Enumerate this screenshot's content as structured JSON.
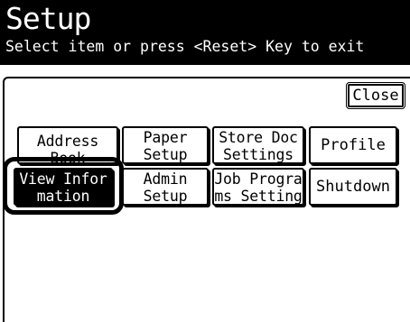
{
  "header": {
    "title": "Setup",
    "subtitle": "Select item or press <Reset> Key to exit"
  },
  "close_button": {
    "label": "Close"
  },
  "menu": {
    "address_book": "Address\nBook",
    "paper_setup": "Paper\nSetup",
    "store_doc_settings": "Store Doc\nSettings",
    "profile": "Profile",
    "view_information": "View Infor\nmation",
    "admin_setup": "Admin\nSetup",
    "job_programs_setting": "Job Progra\nms Setting",
    "shutdown": "Shutdown"
  },
  "colors": {
    "header_bg": "#000000",
    "header_text": "#ffffff",
    "selected_bg": "#000000",
    "button_bg": "#ffffff"
  }
}
